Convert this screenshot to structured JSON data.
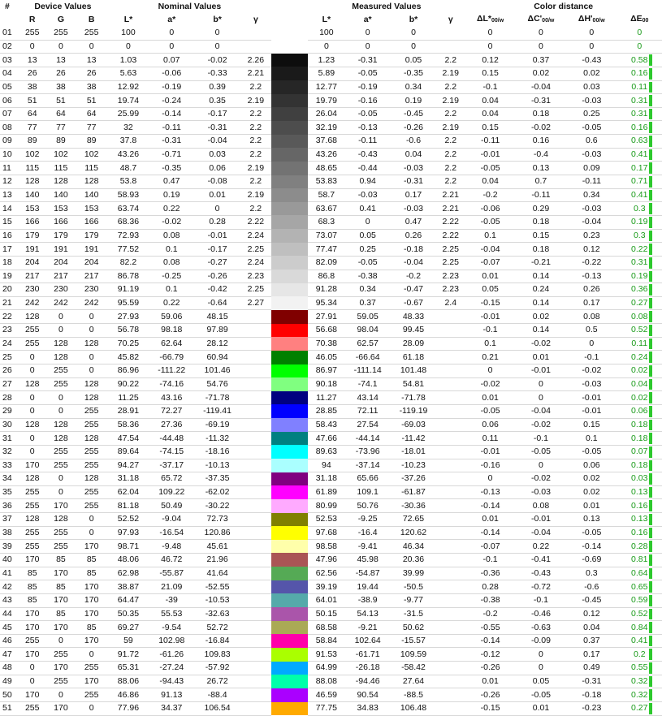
{
  "groups": {
    "device": "Device Values",
    "nominal": "Nominal Values",
    "measured": "Measured Values",
    "distance": "Color distance"
  },
  "cols": {
    "idx": "#",
    "r": "R",
    "g": "G",
    "b": "B",
    "L": "L*",
    "a": "a*",
    "bs": "b*",
    "gamma": "γ",
    "dL": "ΔL*",
    "dL_sub": "00/w",
    "dC": "ΔC'",
    "dC_sub": "00/w",
    "dH": "ΔH'",
    "dH_sub": "00/w",
    "dE": "ΔE",
    "dE_sub": "00"
  },
  "rows": [
    [
      "01",
      "255",
      "255",
      "255",
      "100",
      "0",
      "0",
      "",
      "#ffffff",
      "100",
      "0",
      "0",
      "",
      "0",
      "0",
      "0",
      "0"
    ],
    [
      "02",
      "0",
      "0",
      "0",
      "0",
      "0",
      "0",
      "",
      "#ffffff",
      "0",
      "0",
      "0",
      "",
      "0",
      "0",
      "0",
      "0"
    ],
    [
      "03",
      "13",
      "13",
      "13",
      "1.03",
      "0.07",
      "-0.02",
      "2.26",
      "#0d0d0d",
      "1.23",
      "-0.31",
      "0.05",
      "2.2",
      "0.12",
      "0.37",
      "-0.43",
      "0.58"
    ],
    [
      "04",
      "26",
      "26",
      "26",
      "5.63",
      "-0.06",
      "-0.33",
      "2.21",
      "#1a1a1a",
      "5.89",
      "-0.05",
      "-0.35",
      "2.19",
      "0.15",
      "0.02",
      "0.02",
      "0.16"
    ],
    [
      "05",
      "38",
      "38",
      "38",
      "12.92",
      "-0.19",
      "0.39",
      "2.2",
      "#262626",
      "12.77",
      "-0.19",
      "0.34",
      "2.2",
      "-0.1",
      "-0.04",
      "0.03",
      "0.11"
    ],
    [
      "06",
      "51",
      "51",
      "51",
      "19.74",
      "-0.24",
      "0.35",
      "2.19",
      "#333333",
      "19.79",
      "-0.16",
      "0.19",
      "2.19",
      "0.04",
      "-0.31",
      "-0.03",
      "0.31"
    ],
    [
      "07",
      "64",
      "64",
      "64",
      "25.99",
      "-0.14",
      "-0.17",
      "2.2",
      "#404040",
      "26.04",
      "-0.05",
      "-0.45",
      "2.2",
      "0.04",
      "0.18",
      "0.25",
      "0.31"
    ],
    [
      "08",
      "77",
      "77",
      "77",
      "32",
      "-0.11",
      "-0.31",
      "2.2",
      "#4d4d4d",
      "32.19",
      "-0.13",
      "-0.26",
      "2.19",
      "0.15",
      "-0.02",
      "-0.05",
      "0.16"
    ],
    [
      "09",
      "89",
      "89",
      "89",
      "37.8",
      "-0.31",
      "-0.04",
      "2.2",
      "#595959",
      "37.68",
      "-0.11",
      "-0.6",
      "2.2",
      "-0.11",
      "0.16",
      "0.6",
      "0.63"
    ],
    [
      "10",
      "102",
      "102",
      "102",
      "43.26",
      "-0.71",
      "0.03",
      "2.2",
      "#666666",
      "43.26",
      "-0.43",
      "0.04",
      "2.2",
      "-0.01",
      "-0.4",
      "-0.03",
      "0.41"
    ],
    [
      "11",
      "115",
      "115",
      "115",
      "48.7",
      "-0.35",
      "0.06",
      "2.19",
      "#737373",
      "48.65",
      "-0.44",
      "-0.03",
      "2.2",
      "-0.05",
      "0.13",
      "0.09",
      "0.17"
    ],
    [
      "12",
      "128",
      "128",
      "128",
      "53.8",
      "0.47",
      "-0.08",
      "2.2",
      "#808080",
      "53.83",
      "0.94",
      "-0.31",
      "2.2",
      "0.04",
      "0.7",
      "-0.11",
      "0.71"
    ],
    [
      "13",
      "140",
      "140",
      "140",
      "58.93",
      "0.19",
      "0.01",
      "2.19",
      "#8c8c8c",
      "58.7",
      "-0.03",
      "0.17",
      "2.21",
      "-0.2",
      "-0.11",
      "0.34",
      "0.41"
    ],
    [
      "14",
      "153",
      "153",
      "153",
      "63.74",
      "0.22",
      "0",
      "2.2",
      "#999999",
      "63.67",
      "0.41",
      "-0.03",
      "2.21",
      "-0.06",
      "0.29",
      "-0.03",
      "0.3"
    ],
    [
      "15",
      "166",
      "166",
      "166",
      "68.36",
      "-0.02",
      "0.28",
      "2.22",
      "#a6a6a6",
      "68.3",
      "0",
      "0.47",
      "2.22",
      "-0.05",
      "0.18",
      "-0.04",
      "0.19"
    ],
    [
      "16",
      "179",
      "179",
      "179",
      "72.93",
      "0.08",
      "-0.01",
      "2.24",
      "#b3b3b3",
      "73.07",
      "0.05",
      "0.26",
      "2.22",
      "0.1",
      "0.15",
      "0.23",
      "0.3"
    ],
    [
      "17",
      "191",
      "191",
      "191",
      "77.52",
      "0.1",
      "-0.17",
      "2.25",
      "#bfbfbf",
      "77.47",
      "0.25",
      "-0.18",
      "2.25",
      "-0.04",
      "0.18",
      "0.12",
      "0.22"
    ],
    [
      "18",
      "204",
      "204",
      "204",
      "82.2",
      "0.08",
      "-0.27",
      "2.24",
      "#cccccc",
      "82.09",
      "-0.05",
      "-0.04",
      "2.25",
      "-0.07",
      "-0.21",
      "-0.22",
      "0.31"
    ],
    [
      "19",
      "217",
      "217",
      "217",
      "86.78",
      "-0.25",
      "-0.26",
      "2.23",
      "#d9d9d9",
      "86.8",
      "-0.38",
      "-0.2",
      "2.23",
      "0.01",
      "0.14",
      "-0.13",
      "0.19"
    ],
    [
      "20",
      "230",
      "230",
      "230",
      "91.19",
      "0.1",
      "-0.42",
      "2.25",
      "#e6e6e6",
      "91.28",
      "0.34",
      "-0.47",
      "2.23",
      "0.05",
      "0.24",
      "0.26",
      "0.36"
    ],
    [
      "21",
      "242",
      "242",
      "242",
      "95.59",
      "0.22",
      "-0.64",
      "2.27",
      "#f2f2f2",
      "95.34",
      "0.37",
      "-0.67",
      "2.4",
      "-0.15",
      "0.14",
      "0.17",
      "0.27"
    ],
    [
      "22",
      "128",
      "0",
      "0",
      "27.93",
      "59.06",
      "48.15",
      "",
      "#800000",
      "27.91",
      "59.05",
      "48.33",
      "",
      "-0.01",
      "0.02",
      "0.08",
      "0.08"
    ],
    [
      "23",
      "255",
      "0",
      "0",
      "56.78",
      "98.18",
      "97.89",
      "",
      "#ff0000",
      "56.68",
      "98.04",
      "99.45",
      "",
      "-0.1",
      "0.14",
      "0.5",
      "0.52"
    ],
    [
      "24",
      "255",
      "128",
      "128",
      "70.25",
      "62.64",
      "28.12",
      "",
      "#ff8080",
      "70.38",
      "62.57",
      "28.09",
      "",
      "0.1",
      "-0.02",
      "0",
      "0.11"
    ],
    [
      "25",
      "0",
      "128",
      "0",
      "45.82",
      "-66.79",
      "60.94",
      "",
      "#008000",
      "46.05",
      "-66.64",
      "61.18",
      "",
      "0.21",
      "0.01",
      "-0.1",
      "0.24"
    ],
    [
      "26",
      "0",
      "255",
      "0",
      "86.96",
      "-111.22",
      "101.46",
      "",
      "#00ff00",
      "86.97",
      "-111.14",
      "101.48",
      "",
      "0",
      "-0.01",
      "-0.02",
      "0.02"
    ],
    [
      "27",
      "128",
      "255",
      "128",
      "90.22",
      "-74.16",
      "54.76",
      "",
      "#80ff80",
      "90.18",
      "-74.1",
      "54.81",
      "",
      "-0.02",
      "0",
      "-0.03",
      "0.04"
    ],
    [
      "28",
      "0",
      "0",
      "128",
      "11.25",
      "43.16",
      "-71.78",
      "",
      "#000080",
      "11.27",
      "43.14",
      "-71.78",
      "",
      "0.01",
      "0",
      "-0.01",
      "0.02"
    ],
    [
      "29",
      "0",
      "0",
      "255",
      "28.91",
      "72.27",
      "-119.41",
      "",
      "#0000ff",
      "28.85",
      "72.11",
      "-119.19",
      "",
      "-0.05",
      "-0.04",
      "-0.01",
      "0.06"
    ],
    [
      "30",
      "128",
      "128",
      "255",
      "58.36",
      "27.36",
      "-69.19",
      "",
      "#8080ff",
      "58.43",
      "27.54",
      "-69.03",
      "",
      "0.06",
      "-0.02",
      "0.15",
      "0.18"
    ],
    [
      "31",
      "0",
      "128",
      "128",
      "47.54",
      "-44.48",
      "-11.32",
      "",
      "#008080",
      "47.66",
      "-44.14",
      "-11.42",
      "",
      "0.11",
      "-0.1",
      "0.1",
      "0.18"
    ],
    [
      "32",
      "0",
      "255",
      "255",
      "89.64",
      "-74.15",
      "-18.16",
      "",
      "#00ffff",
      "89.63",
      "-73.96",
      "-18.01",
      "",
      "-0.01",
      "-0.05",
      "-0.05",
      "0.07"
    ],
    [
      "33",
      "170",
      "255",
      "255",
      "94.27",
      "-37.17",
      "-10.13",
      "",
      "#aaffff",
      "94",
      "-37.14",
      "-10.23",
      "",
      "-0.16",
      "0",
      "0.06",
      "0.18"
    ],
    [
      "34",
      "128",
      "0",
      "128",
      "31.18",
      "65.72",
      "-37.35",
      "",
      "#800080",
      "31.18",
      "65.66",
      "-37.26",
      "",
      "0",
      "-0.02",
      "0.02",
      "0.03"
    ],
    [
      "35",
      "255",
      "0",
      "255",
      "62.04",
      "109.22",
      "-62.02",
      "",
      "#ff00ff",
      "61.89",
      "109.1",
      "-61.87",
      "",
      "-0.13",
      "-0.03",
      "0.02",
      "0.13"
    ],
    [
      "36",
      "255",
      "170",
      "255",
      "81.18",
      "50.49",
      "-30.22",
      "",
      "#ffaaff",
      "80.99",
      "50.76",
      "-30.36",
      "",
      "-0.14",
      "0.08",
      "0.01",
      "0.16"
    ],
    [
      "37",
      "128",
      "128",
      "0",
      "52.52",
      "-9.04",
      "72.73",
      "",
      "#808000",
      "52.53",
      "-9.25",
      "72.65",
      "",
      "0.01",
      "-0.01",
      "0.13",
      "0.13"
    ],
    [
      "38",
      "255",
      "255",
      "0",
      "97.93",
      "-16.54",
      "120.86",
      "",
      "#ffff00",
      "97.68",
      "-16.4",
      "120.62",
      "",
      "-0.14",
      "-0.04",
      "-0.05",
      "0.16"
    ],
    [
      "39",
      "255",
      "255",
      "170",
      "98.71",
      "-9.48",
      "45.61",
      "",
      "#ffffaa",
      "98.58",
      "-9.41",
      "46.34",
      "",
      "-0.07",
      "0.22",
      "-0.14",
      "0.28"
    ],
    [
      "40",
      "170",
      "85",
      "85",
      "48.06",
      "46.72",
      "21.96",
      "",
      "#aa5555",
      "47.96",
      "45.98",
      "20.36",
      "",
      "-0.1",
      "-0.41",
      "-0.69",
      "0.81"
    ],
    [
      "41",
      "85",
      "170",
      "85",
      "62.98",
      "-55.87",
      "41.64",
      "",
      "#55aa55",
      "62.56",
      "-54.87",
      "39.99",
      "",
      "-0.36",
      "-0.43",
      "0.3",
      "0.64"
    ],
    [
      "42",
      "85",
      "85",
      "170",
      "38.87",
      "21.09",
      "-52.55",
      "",
      "#5555aa",
      "39.19",
      "19.44",
      "-50.5",
      "",
      "0.28",
      "-0.72",
      "-0.6",
      "0.65"
    ],
    [
      "43",
      "85",
      "170",
      "170",
      "64.47",
      "-39",
      "-10.53",
      "",
      "#55aaaa",
      "64.01",
      "-38.9",
      "-9.77",
      "",
      "-0.38",
      "-0.1",
      "-0.45",
      "0.59"
    ],
    [
      "44",
      "170",
      "85",
      "170",
      "50.35",
      "55.53",
      "-32.63",
      "",
      "#aa55aa",
      "50.15",
      "54.13",
      "-31.5",
      "",
      "-0.2",
      "-0.46",
      "0.12",
      "0.52"
    ],
    [
      "45",
      "170",
      "170",
      "85",
      "69.27",
      "-9.54",
      "52.72",
      "",
      "#aaaa55",
      "68.58",
      "-9.21",
      "50.62",
      "",
      "-0.55",
      "-0.63",
      "0.04",
      "0.84"
    ],
    [
      "46",
      "255",
      "0",
      "170",
      "59",
      "102.98",
      "-16.84",
      "",
      "#ff00aa",
      "58.84",
      "102.64",
      "-15.57",
      "",
      "-0.14",
      "-0.09",
      "0.37",
      "0.41"
    ],
    [
      "47",
      "170",
      "255",
      "0",
      "91.72",
      "-61.26",
      "109.83",
      "",
      "#aaff00",
      "91.53",
      "-61.71",
      "109.59",
      "",
      "-0.12",
      "0",
      "0.17",
      "0.2"
    ],
    [
      "48",
      "0",
      "170",
      "255",
      "65.31",
      "-27.24",
      "-57.92",
      "",
      "#00aaff",
      "64.99",
      "-26.18",
      "-58.42",
      "",
      "-0.26",
      "0",
      "0.49",
      "0.55"
    ],
    [
      "49",
      "0",
      "255",
      "170",
      "88.06",
      "-94.43",
      "26.72",
      "",
      "#00ffaa",
      "88.08",
      "-94.46",
      "27.64",
      "",
      "0.01",
      "0.05",
      "-0.31",
      "0.32"
    ],
    [
      "50",
      "170",
      "0",
      "255",
      "46.86",
      "91.13",
      "-88.4",
      "",
      "#aa00ff",
      "46.59",
      "90.54",
      "-88.5",
      "",
      "-0.26",
      "-0.05",
      "-0.18",
      "0.32"
    ],
    [
      "51",
      "255",
      "170",
      "0",
      "77.96",
      "34.37",
      "106.54",
      "",
      "#ffaa00",
      "77.75",
      "34.83",
      "106.48",
      "",
      "-0.15",
      "0.01",
      "-0.23",
      "0.27"
    ]
  ]
}
